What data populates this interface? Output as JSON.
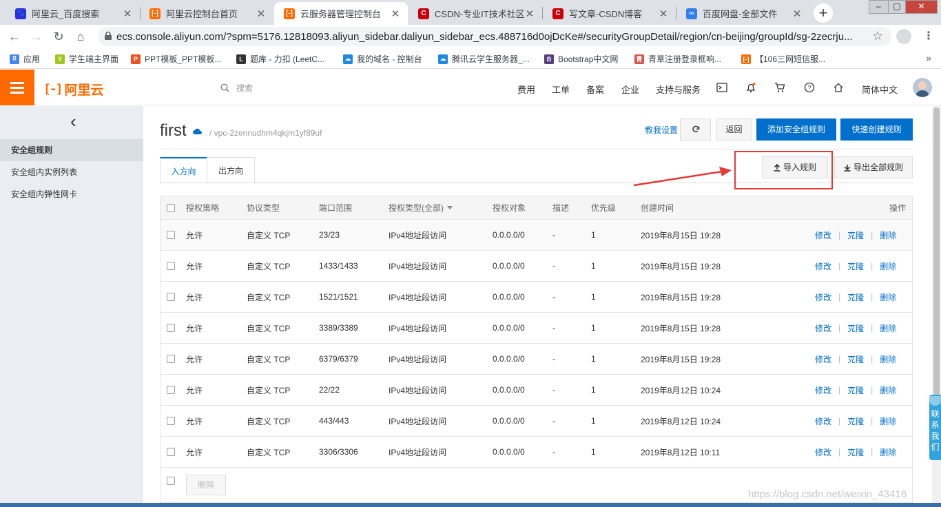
{
  "browser": {
    "tabs": [
      {
        "title": "阿里云_百度搜索",
        "icon": "paw-icon",
        "color": "#2932e1",
        "glyph": "🐾"
      },
      {
        "title": "阿里云控制台首页",
        "icon": "aliyun-icon",
        "color": "#ff6a00",
        "glyph": "[-]"
      },
      {
        "title": "云服务器管理控制台",
        "icon": "aliyun-icon",
        "color": "#ff6a00",
        "glyph": "[-]",
        "active": true
      },
      {
        "title": "CSDN-专业IT技术社区",
        "icon": "csdn-icon",
        "color": "#c9000c",
        "glyph": "C"
      },
      {
        "title": "写文章-CSDN博客",
        "icon": "csdn-icon",
        "color": "#c9000c",
        "glyph": "C"
      },
      {
        "title": "百度网盘-全部文件",
        "icon": "baidu-pan-icon",
        "color": "#2f80ed",
        "glyph": "∞"
      }
    ],
    "url": "ecs.console.aliyun.com/?spm=5176.12818093.aliyun_sidebar.daliyun_sidebar_ecs.488716d0ojDcKe#/securityGroupDetail/region/cn-beijing/groupId/sg-2zecrju...",
    "bookmarks": [
      {
        "label": "应用",
        "icon": "apps-grid-icon",
        "color": "#4285f4"
      },
      {
        "label": "学生端主界面",
        "icon": "y-icon",
        "color": "#9ec61f"
      },
      {
        "label": "PPT模板_PPT模板...",
        "icon": "ppt-icon",
        "color": "#f25022"
      },
      {
        "label": "题库 - 力扣 (LeetC...",
        "icon": "leetcode-icon",
        "color": "#333333"
      },
      {
        "label": "我的域名 - 控制台",
        "icon": "cloud-icon",
        "color": "#1e88e5"
      },
      {
        "label": "腾讯云学生服务器_...",
        "icon": "cloud-icon",
        "color": "#1e88e5"
      },
      {
        "label": "Bootstrap中文网",
        "icon": "bootstrap-icon",
        "color": "#563d7c"
      },
      {
        "label": "青草注册登录框响...",
        "icon": "grass-icon",
        "color": "#d9534f"
      },
      {
        "label": "【106三网短信服...",
        "icon": "aliyun-icon",
        "color": "#ff6a00"
      }
    ]
  },
  "header": {
    "logo": "阿里云",
    "search_placeholder": "搜索",
    "nav": [
      "费用",
      "工单",
      "备案",
      "企业",
      "支持与服务"
    ],
    "language": "简体中文"
  },
  "sidebar": {
    "items": [
      {
        "label": "安全组规则",
        "active": true
      },
      {
        "label": "安全组内实例列表",
        "active": false
      },
      {
        "label": "安全组内弹性网卡",
        "active": false
      }
    ]
  },
  "page": {
    "title": "first",
    "vpc": "/ vpc-2zennudhm4qkjm1yf89uf",
    "help_link": "教我设置",
    "back_button": "返回",
    "add_rule_button": "添加安全组规则",
    "quick_create_button": "快速创建规则",
    "import_button": "导入规则",
    "export_button": "导出全部规则",
    "tabs": [
      "入方向",
      "出方向"
    ]
  },
  "table": {
    "columns": [
      "授权策略",
      "协议类型",
      "端口范围",
      "授权类型(全部)",
      "授权对象",
      "描述",
      "优先级",
      "创建时间",
      "操作"
    ],
    "actions": [
      "修改",
      "克隆",
      "删除"
    ],
    "rows": [
      {
        "policy": "允许",
        "protocol": "自定义 TCP",
        "port": "23/23",
        "auth_type": "IPv4地址段访问",
        "object": "0.0.0.0/0",
        "desc": "-",
        "priority": "1",
        "time": "2019年8月15日 19:28"
      },
      {
        "policy": "允许",
        "protocol": "自定义 TCP",
        "port": "1433/1433",
        "auth_type": "IPv4地址段访问",
        "object": "0.0.0.0/0",
        "desc": "-",
        "priority": "1",
        "time": "2019年8月15日 19:28"
      },
      {
        "policy": "允许",
        "protocol": "自定义 TCP",
        "port": "1521/1521",
        "auth_type": "IPv4地址段访问",
        "object": "0.0.0.0/0",
        "desc": "-",
        "priority": "1",
        "time": "2019年8月15日 19:28"
      },
      {
        "policy": "允许",
        "protocol": "自定义 TCP",
        "port": "3389/3389",
        "auth_type": "IPv4地址段访问",
        "object": "0.0.0.0/0",
        "desc": "-",
        "priority": "1",
        "time": "2019年8月15日 19:28"
      },
      {
        "policy": "允许",
        "protocol": "自定义 TCP",
        "port": "6379/6379",
        "auth_type": "IPv4地址段访问",
        "object": "0.0.0.0/0",
        "desc": "-",
        "priority": "1",
        "time": "2019年8月15日 19:28"
      },
      {
        "policy": "允许",
        "protocol": "自定义 TCP",
        "port": "22/22",
        "auth_type": "IPv4地址段访问",
        "object": "0.0.0.0/0",
        "desc": "-",
        "priority": "1",
        "time": "2019年8月12日 10:24"
      },
      {
        "policy": "允许",
        "protocol": "自定义 TCP",
        "port": "443/443",
        "auth_type": "IPv4地址段访问",
        "object": "0.0.0.0/0",
        "desc": "-",
        "priority": "1",
        "time": "2019年8月12日 10:24"
      },
      {
        "policy": "允许",
        "protocol": "自定义 TCP",
        "port": "3306/3306",
        "auth_type": "IPv4地址段访问",
        "object": "0.0.0.0/0",
        "desc": "-",
        "priority": "1",
        "time": "2019年8月12日 10:11"
      }
    ],
    "delete_button": "删除"
  },
  "contact_widget": "联系我们",
  "watermark": "https://blog.csdn.net/weixin_43416"
}
